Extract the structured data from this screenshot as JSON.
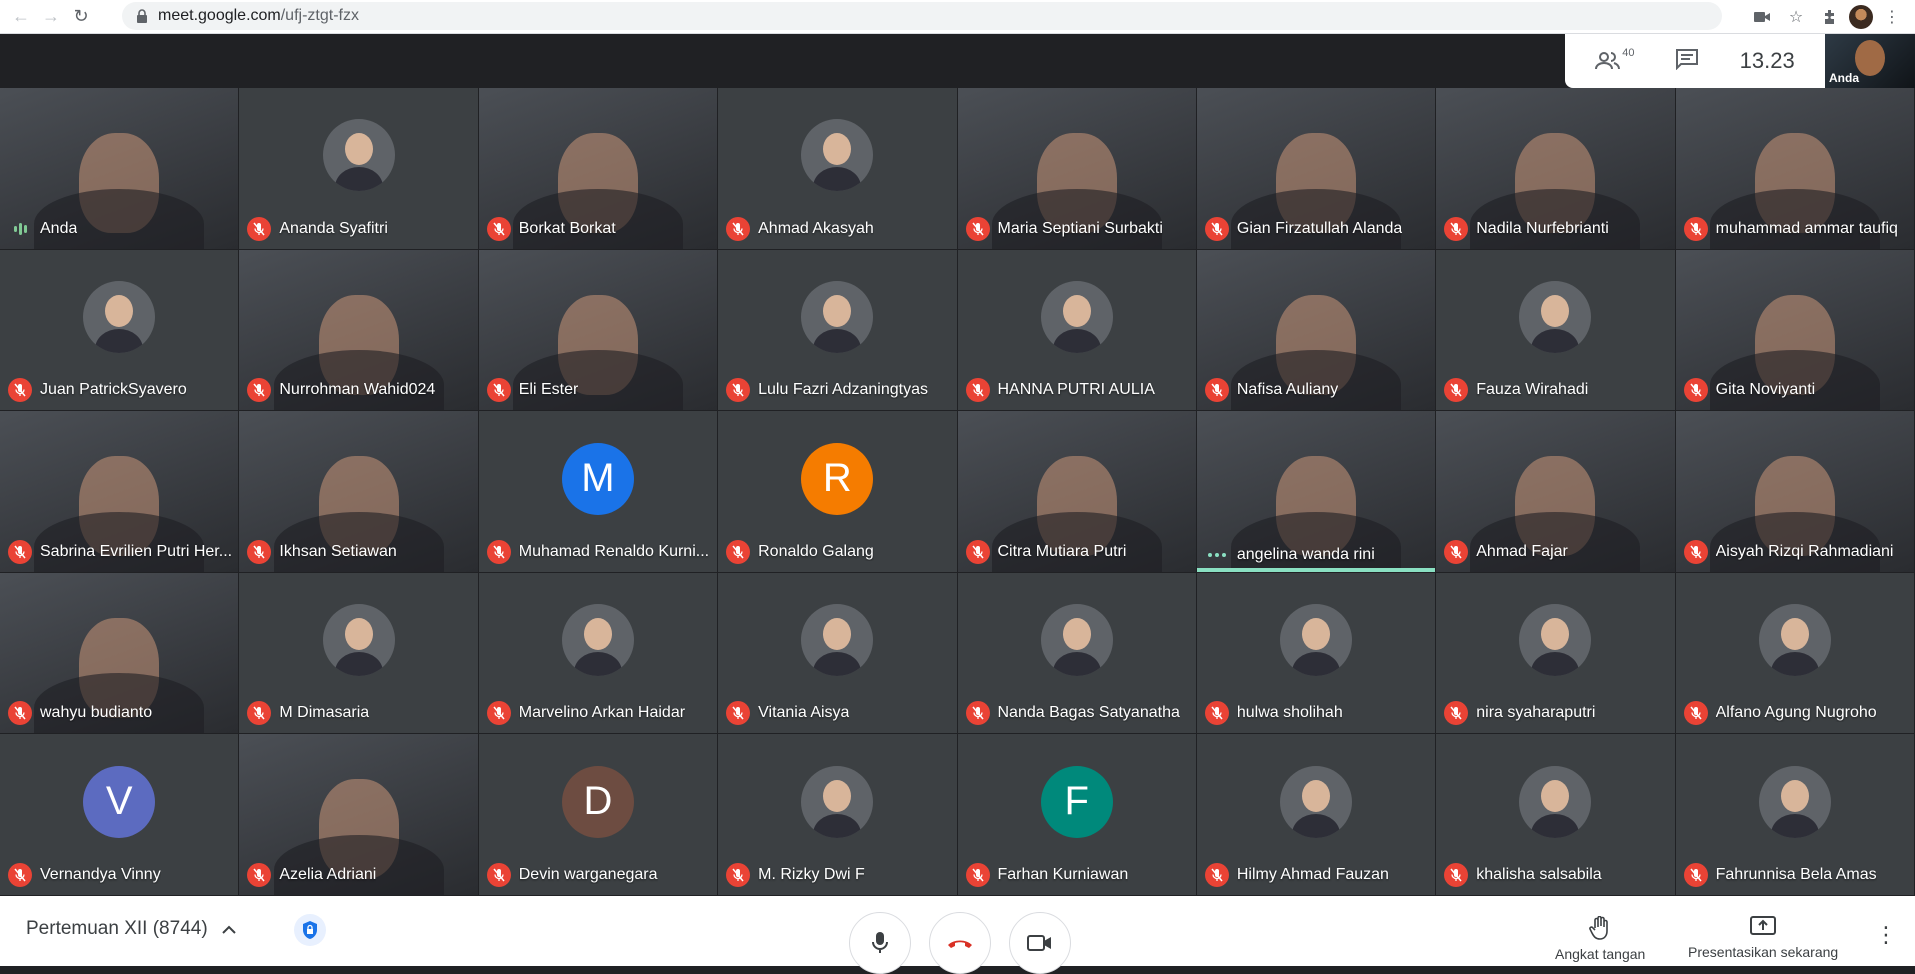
{
  "browser": {
    "url_host": "meet.google.com",
    "url_path": "/ufj-ztgt-fzx"
  },
  "meet": {
    "people_count": "40",
    "clock": "13.23",
    "self_label": "Anda"
  },
  "participants": [
    {
      "name": "Anda",
      "state": "speaking",
      "kind": "video"
    },
    {
      "name": "Ananda Syafitri",
      "state": "muted",
      "kind": "photo"
    },
    {
      "name": "Borkat Borkat",
      "state": "muted",
      "kind": "video"
    },
    {
      "name": "Ahmad Akasyah",
      "state": "muted",
      "kind": "photo"
    },
    {
      "name": "Maria Septiani Surbakti",
      "state": "muted",
      "kind": "video"
    },
    {
      "name": "Gian Firzatullah Alanda",
      "state": "muted",
      "kind": "video"
    },
    {
      "name": "Nadila Nurfebrianti",
      "state": "muted",
      "kind": "video"
    },
    {
      "name": "muhammad ammar taufiq",
      "state": "muted",
      "kind": "video"
    },
    {
      "name": "Juan PatrickSyavero",
      "state": "muted",
      "kind": "photo"
    },
    {
      "name": "Nurrohman Wahid024",
      "state": "muted",
      "kind": "video"
    },
    {
      "name": "Eli Ester",
      "state": "muted",
      "kind": "video"
    },
    {
      "name": "Lulu Fazri Adzaningtyas",
      "state": "muted",
      "kind": "photo"
    },
    {
      "name": "HANNA PUTRI AULIA",
      "state": "muted",
      "kind": "photo"
    },
    {
      "name": "Nafisa Auliany",
      "state": "muted",
      "kind": "video"
    },
    {
      "name": "Fauza Wirahadi",
      "state": "muted",
      "kind": "photo"
    },
    {
      "name": "Gita Noviyanti",
      "state": "muted",
      "kind": "video"
    },
    {
      "name": "Sabrina Evrilien Putri Her...",
      "state": "muted",
      "kind": "video"
    },
    {
      "name": "Ikhsan Setiawan",
      "state": "muted",
      "kind": "video"
    },
    {
      "name": "Muhamad Renaldo Kurni...",
      "state": "muted",
      "kind": "letter",
      "initial": "M",
      "color": "#1a73e8"
    },
    {
      "name": "Ronaldo Galang",
      "state": "muted",
      "kind": "letter",
      "initial": "R",
      "color": "#f57c00"
    },
    {
      "name": "Citra Mutiara Putri",
      "state": "muted",
      "kind": "video"
    },
    {
      "name": "angelina wanda rini",
      "state": "active",
      "kind": "video"
    },
    {
      "name": "Ahmad Fajar",
      "state": "muted",
      "kind": "video"
    },
    {
      "name": "Aisyah Rizqi Rahmadiani",
      "state": "muted",
      "kind": "video"
    },
    {
      "name": "wahyu budianto",
      "state": "muted",
      "kind": "video"
    },
    {
      "name": "M Dimasaria",
      "state": "muted",
      "kind": "photo"
    },
    {
      "name": "Marvelino Arkan Haidar",
      "state": "muted",
      "kind": "photo"
    },
    {
      "name": "Vitania Aisya",
      "state": "muted",
      "kind": "photo"
    },
    {
      "name": "Nanda Bagas Satyanatha",
      "state": "muted",
      "kind": "photo"
    },
    {
      "name": "hulwa sholihah",
      "state": "muted",
      "kind": "photo"
    },
    {
      "name": "nira syaharaputri",
      "state": "muted",
      "kind": "photo"
    },
    {
      "name": "Alfano Agung Nugroho",
      "state": "muted",
      "kind": "photo"
    },
    {
      "name": "Vernandya Vinny",
      "state": "muted",
      "kind": "letter",
      "initial": "V",
      "color": "#5c6bc0"
    },
    {
      "name": "Azelia Adriani",
      "state": "muted",
      "kind": "video"
    },
    {
      "name": "Devin warganegara",
      "state": "muted",
      "kind": "letter",
      "initial": "D",
      "color": "#6d4c41"
    },
    {
      "name": "M. Rizky Dwi F",
      "state": "muted",
      "kind": "photo"
    },
    {
      "name": "Farhan Kurniawan",
      "state": "muted",
      "kind": "letter",
      "initial": "F",
      "color": "#00897b"
    },
    {
      "name": "Hilmy Ahmad Fauzan",
      "state": "muted",
      "kind": "photo"
    },
    {
      "name": "khalisha salsabila",
      "state": "muted",
      "kind": "photo"
    },
    {
      "name": "Fahrunnisa Bela Amas",
      "state": "muted",
      "kind": "photo"
    }
  ],
  "bottom_bar": {
    "meeting_title": "Pertemuan XII (8744)",
    "raise_hand_label": "Angkat tangan",
    "present_label": "Presentasikan sekarang"
  },
  "colors": {
    "mute_red": "#ea4335",
    "active_teal": "#8ae0c2",
    "tile_bg": "#3c4043",
    "page_bg": "#202124"
  }
}
